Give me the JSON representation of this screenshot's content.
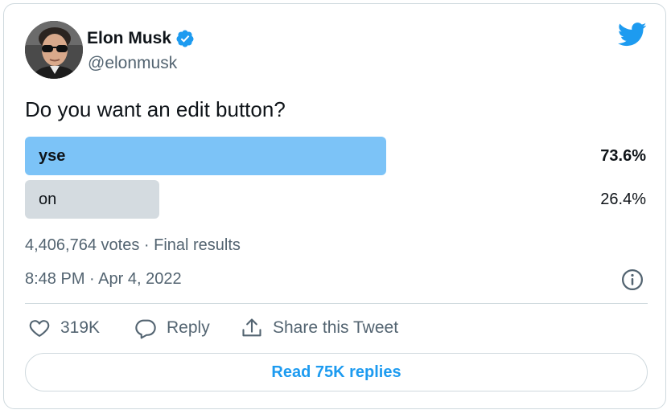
{
  "author": {
    "name": "Elon Musk",
    "handle": "@elonmusk",
    "verified": true
  },
  "icons": {
    "brand": "twitter-bird-icon",
    "verified": "verified-badge-icon",
    "info": "info-icon",
    "like": "heart-icon",
    "reply": "reply-bubble-icon",
    "share": "share-icon"
  },
  "colors": {
    "brand_blue": "#1d9bf0",
    "winner_bar": "#7cc3f7",
    "loser_bar": "#d4dbe0",
    "text_primary": "#0f1419",
    "text_secondary": "#536471",
    "border": "#cfd9de"
  },
  "tweet": {
    "text": "Do you want an edit button?"
  },
  "poll": {
    "options": [
      {
        "label": "yse",
        "percent_label": "73.6%",
        "percent": 73.6,
        "winner": true
      },
      {
        "label": "on",
        "percent_label": "26.4%",
        "percent": 26.4,
        "winner": false
      }
    ],
    "summary": "4,406,764 votes · Final results"
  },
  "timestamp": "8:48 PM · Apr 4, 2022",
  "actions": {
    "like_count": "319K",
    "reply_label": "Reply",
    "share_label": "Share this Tweet"
  },
  "read_replies_label": "Read 75K replies"
}
